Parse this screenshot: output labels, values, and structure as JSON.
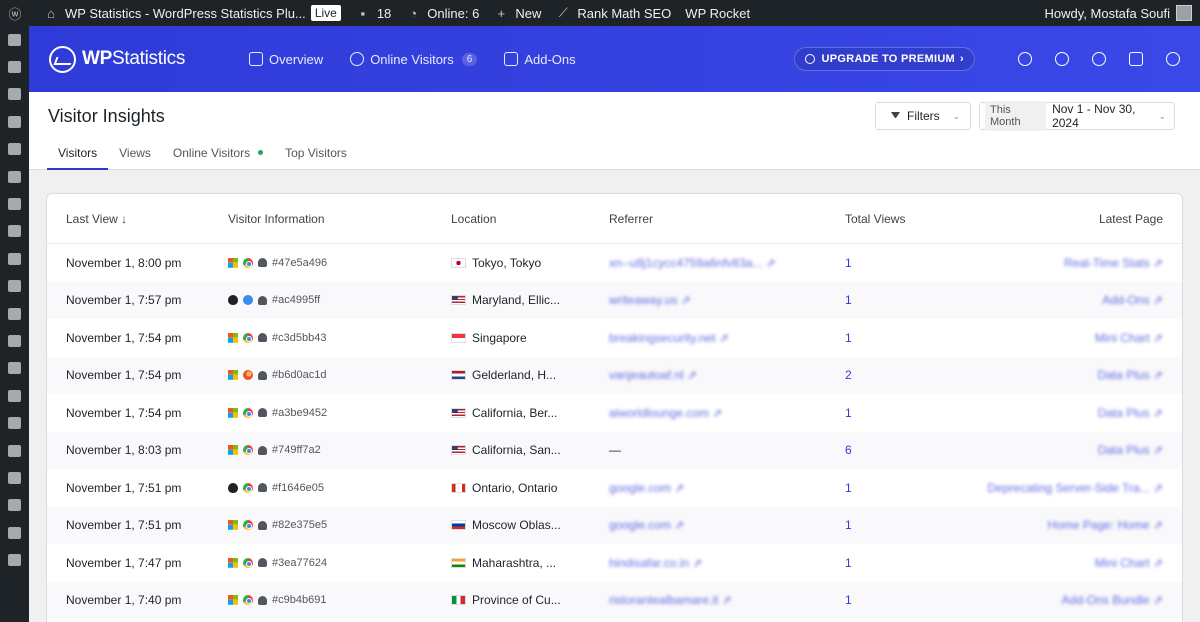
{
  "adminbar": {
    "site_title": "WP Statistics - WordPress Statistics Plu...",
    "live_label": "Live",
    "comments_count": "18",
    "online_label": "Online: 6",
    "new_label": "New",
    "rankmath_label": "Rank Math SEO",
    "wprocket_label": "WP Rocket",
    "howdy_label": "Howdy, Mostafa Soufi"
  },
  "header": {
    "logo_text_bold": "WP",
    "logo_text_rest": "Statistics",
    "nav": [
      {
        "label": "Overview"
      },
      {
        "label": "Online Visitors",
        "count": "6"
      },
      {
        "label": "Add-Ons"
      }
    ],
    "upgrade_label": "UPGRADE TO PREMIUM",
    "icons": [
      "notice-icon",
      "speed-icon",
      "settings-icon",
      "help-icon",
      "smile-icon"
    ]
  },
  "subheader": {
    "title": "Visitor Insights",
    "filters_label": "Filters",
    "date_preset": "This Month",
    "date_range": "Nov 1 - Nov 30, 2024",
    "tabs": [
      "Visitors",
      "Views",
      "Online Visitors",
      "Top Visitors"
    ]
  },
  "table": {
    "headers": {
      "last_view": "Last View ↓",
      "visitor_info": "Visitor Information",
      "location": "Location",
      "referrer": "Referrer",
      "total_views": "Total Views",
      "latest_page": "Latest Page"
    },
    "rows": [
      {
        "last_view": "November 1, 8:00 pm",
        "os": "windows",
        "browser": "chrome",
        "hash": "#47e5a496",
        "flag": "jp",
        "location": "Tokyo, Tokyo",
        "referrer": "xn--u8j1cycc4759a6nfv83a...",
        "views": "1",
        "page": "Real-Time Stats"
      },
      {
        "last_view": "November 1, 7:57 pm",
        "os": "mac",
        "browser": "safari",
        "hash": "#ac4995ff",
        "flag": "us",
        "location": "Maryland, Ellic...",
        "referrer": "writeaway.us",
        "views": "1",
        "page": "Add-Ons"
      },
      {
        "last_view": "November 1, 7:54 pm",
        "os": "windows",
        "browser": "chrome",
        "hash": "#c3d5bb43",
        "flag": "sg",
        "location": "Singapore",
        "referrer": "breakingsecurity.net",
        "views": "1",
        "page": "Mini Chart"
      },
      {
        "last_view": "November 1, 7:54 pm",
        "os": "windows",
        "browser": "firefox",
        "hash": "#b6d0ac1d",
        "flag": "nl",
        "location": "Gelderland, H...",
        "referrer": "vanjeautoaf.nl",
        "views": "2",
        "page": "Data Plus"
      },
      {
        "last_view": "November 1, 7:54 pm",
        "os": "windows",
        "browser": "chrome",
        "hash": "#a3be9452",
        "flag": "us",
        "location": "California, Ber...",
        "referrer": "aiworldlounge.com",
        "views": "1",
        "page": "Data Plus"
      },
      {
        "last_view": "November 1, 8:03 pm",
        "os": "windows",
        "browser": "chrome",
        "hash": "#749ff7a2",
        "flag": "us",
        "location": "California, San...",
        "referrer": "—",
        "views": "6",
        "page": "Data Plus"
      },
      {
        "last_view": "November 1, 7:51 pm",
        "os": "mac",
        "browser": "chrome",
        "hash": "#f1646e05",
        "flag": "ca",
        "location": "Ontario, Ontario",
        "referrer": "google.com",
        "views": "1",
        "page": "Deprecating Server-Side Tra..."
      },
      {
        "last_view": "November 1, 7:51 pm",
        "os": "windows",
        "browser": "chrome",
        "hash": "#82e375e5",
        "flag": "ru",
        "location": "Moscow Oblas...",
        "referrer": "google.com",
        "views": "1",
        "page": "Home Page: Home"
      },
      {
        "last_view": "November 1, 7:47 pm",
        "os": "windows",
        "browser": "chrome",
        "hash": "#3ea77624",
        "flag": "in",
        "location": "Maharashtra, ...",
        "referrer": "hindisafar.co.in",
        "views": "1",
        "page": "Mini Chart"
      },
      {
        "last_view": "November 1, 7:40 pm",
        "os": "windows",
        "browser": "chrome",
        "hash": "#c9b4b691",
        "flag": "it",
        "location": "Province of Cu...",
        "referrer": "ristorantealbamare.it",
        "views": "1",
        "page": "Add-Ons Bundle"
      }
    ]
  },
  "colors": {
    "header_blue": "#2f3bd8",
    "link_blue": "#2f3bd8",
    "online_dot": "#21a85c"
  }
}
